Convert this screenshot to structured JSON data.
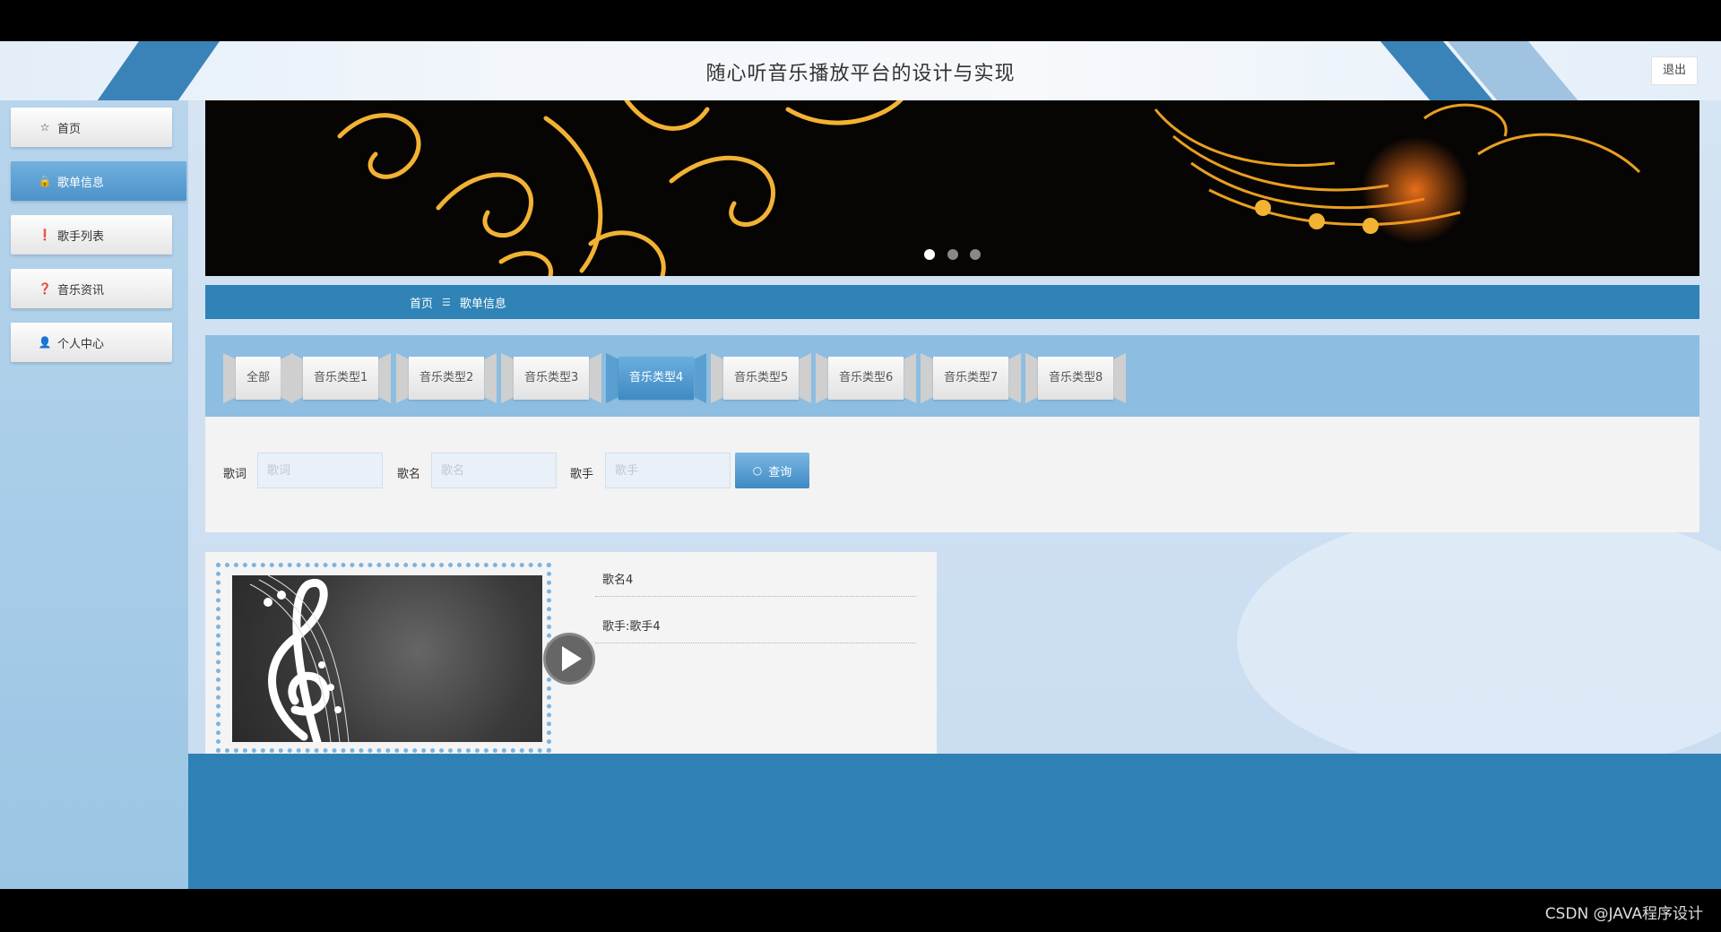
{
  "header": {
    "title": "随心听音乐播放平台的设计与实现",
    "logout_label": "退出"
  },
  "sidebar": {
    "items": [
      {
        "icon": "star-icon",
        "glyph": "☆",
        "label": "首页"
      },
      {
        "icon": "lock-icon",
        "glyph": "🔒",
        "label": "歌单信息"
      },
      {
        "icon": "alert-icon",
        "glyph": "❗",
        "label": "歌手列表"
      },
      {
        "icon": "help-icon",
        "glyph": "❓",
        "label": "音乐资讯"
      },
      {
        "icon": "user-icon",
        "glyph": "👤",
        "label": "个人中心"
      }
    ],
    "active_index": 1
  },
  "banner": {
    "slide_count": 3,
    "active_slide": 1
  },
  "breadcrumb": {
    "home": "首页",
    "separator": "☰",
    "current": "歌单信息"
  },
  "categories": {
    "items": [
      "全部",
      "音乐类型1",
      "音乐类型2",
      "音乐类型3",
      "音乐类型4",
      "音乐类型5",
      "音乐类型6",
      "音乐类型7",
      "音乐类型8"
    ],
    "active_index": 4
  },
  "search": {
    "lyrics_label": "歌词",
    "lyrics_placeholder": "歌词",
    "name_label": "歌名",
    "name_placeholder": "歌名",
    "singer_label": "歌手",
    "singer_placeholder": "歌手",
    "query_label": "查询"
  },
  "song": {
    "name": "歌名4",
    "singer_line": "歌手:歌手4"
  },
  "watermark": "CSDN @JAVA程序设计",
  "colors": {
    "accent": "#2f83b6",
    "sidebar": "#9ac5e4",
    "active": "#4c92c9"
  }
}
